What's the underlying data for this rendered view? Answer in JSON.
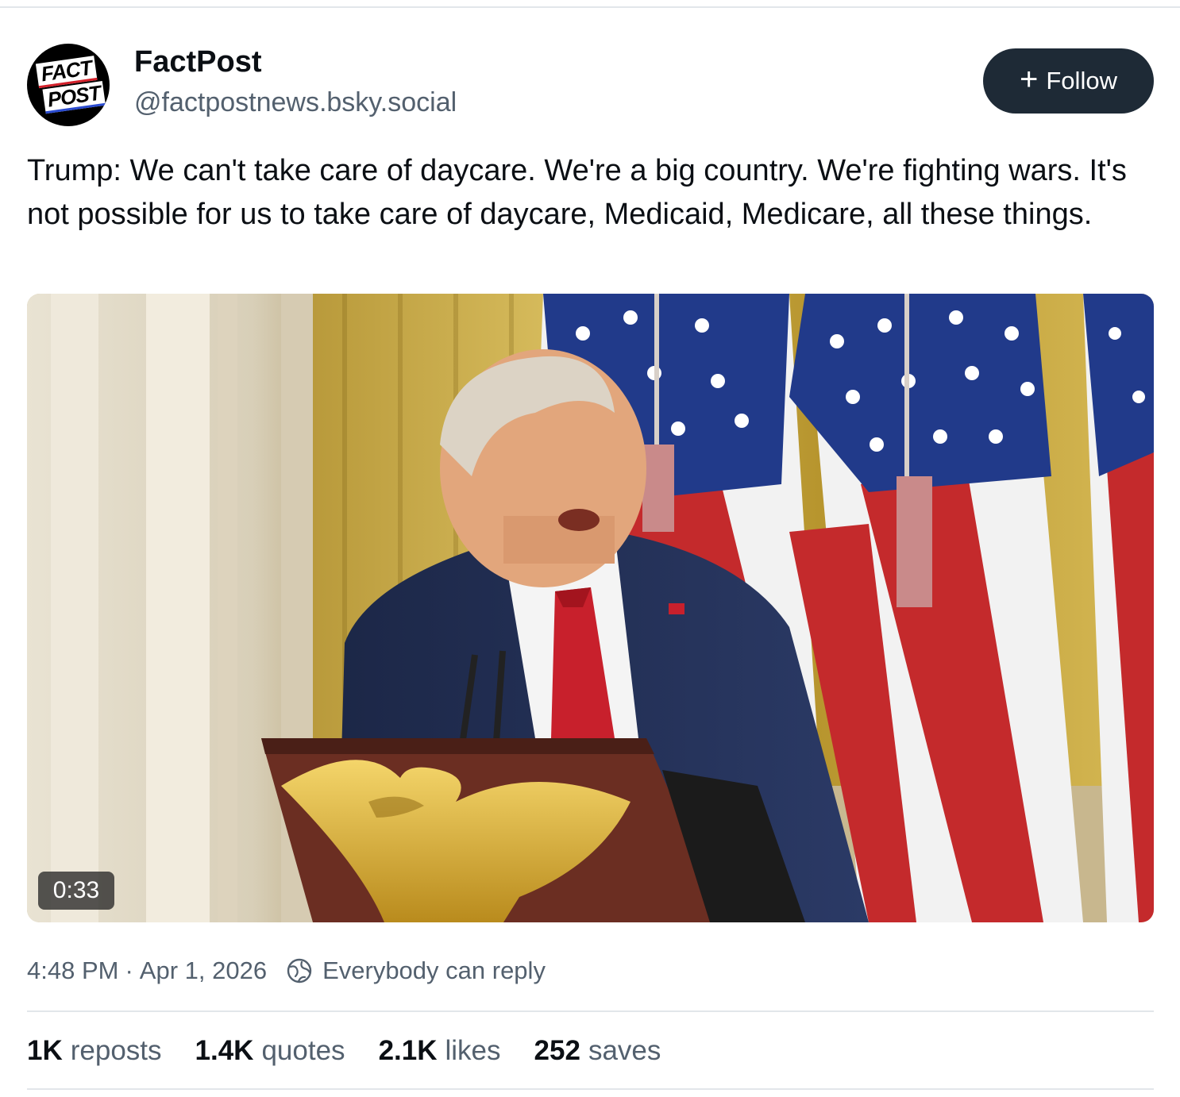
{
  "author": {
    "display_name": "FactPost",
    "handle": "@factpostnews.bsky.social",
    "avatar_line1": "FACT",
    "avatar_line2": "POST"
  },
  "follow_button": {
    "icon": "plus-icon",
    "label": "Follow"
  },
  "post": {
    "text": "Trump: We can't take care of daycare. We're a big country. We're fighting wars. It's not possible for us to take care of daycare, Medicaid, Medicare, all these things."
  },
  "video": {
    "duration": "0:33"
  },
  "meta": {
    "time": "4:48 PM",
    "separator": "·",
    "date": "Apr 1, 2026",
    "reply_icon": "globe-icon",
    "reply_setting": "Everybody can reply"
  },
  "stats": [
    {
      "value": "1K",
      "label": "reposts"
    },
    {
      "value": "1.4K",
      "label": "quotes"
    },
    {
      "value": "2.1K",
      "label": "likes"
    },
    {
      "value": "252",
      "label": "saves"
    }
  ],
  "colors": {
    "button_bg": "#1e2a36",
    "muted_text": "#53606e",
    "divider": "#e2e6ea"
  }
}
